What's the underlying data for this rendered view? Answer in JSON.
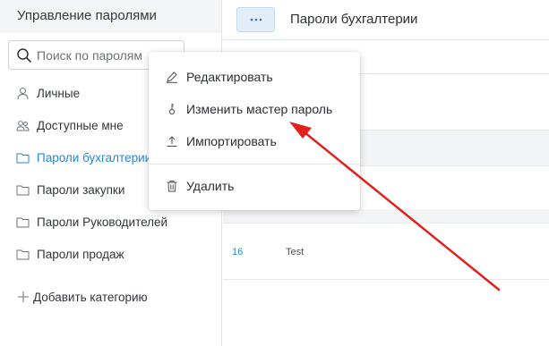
{
  "sidebar": {
    "title": "Управление паролями",
    "search_placeholder": "Поиск по паролям",
    "items": [
      {
        "label": "Личные",
        "icon": "person-icon"
      },
      {
        "label": "Доступные мне",
        "icon": "people-icon"
      },
      {
        "label": "Пароли бухгалтерии",
        "icon": "folder-icon",
        "active": true
      },
      {
        "label": "Пароли закупки",
        "icon": "folder-icon"
      },
      {
        "label": "Пароли Руководителей",
        "icon": "folder-icon"
      },
      {
        "label": "Пароли продаж",
        "icon": "folder-icon"
      }
    ],
    "add_category": "Добавить категорию"
  },
  "header": {
    "more_button": "···",
    "title": "Пароли бухгалтерии"
  },
  "menu": {
    "items": [
      {
        "label": "Редактировать",
        "icon": "pencil-icon"
      },
      {
        "label": "Изменить мастер пароль",
        "icon": "key-icon"
      },
      {
        "label": "Импортировать",
        "icon": "upload-icon"
      },
      {
        "label": "Удалить",
        "icon": "trash-icon"
      }
    ]
  },
  "table": {
    "rows": [
      {
        "num": "16",
        "name": "Test"
      }
    ]
  },
  "colors": {
    "accent": "#2a86d9",
    "arrow": "#e0211d"
  }
}
